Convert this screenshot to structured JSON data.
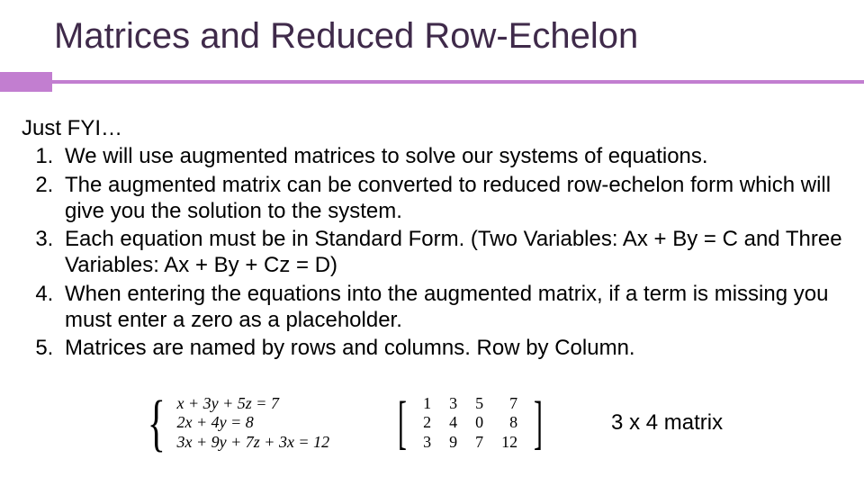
{
  "title": "Matrices and Reduced Row-Echelon",
  "intro": "Just FYI…",
  "items": [
    "We will use augmented matrices to solve our systems of equations.",
    "The augmented matrix can be converted to reduced row-echelon form which will give you the solution to the system.",
    "Each equation must be in Standard Form. (Two Variables: Ax + By = C and Three Variables: Ax + By + Cz = D)",
    "When entering the equations into the augmented matrix, if a term is missing you must enter a zero as a placeholder.",
    "Matrices are named by rows and columns. Row by Column."
  ],
  "equations": [
    "x + 3y + 5z = 7",
    "2x + 4y = 8",
    "3x + 9y + 7z + 3x = 12"
  ],
  "matrix": {
    "rows": [
      [
        "1",
        "3",
        "5",
        "7"
      ],
      [
        "2",
        "4",
        "0",
        "8"
      ],
      [
        "3",
        "9",
        "7",
        "12"
      ]
    ]
  },
  "caption": "3 x 4 matrix"
}
